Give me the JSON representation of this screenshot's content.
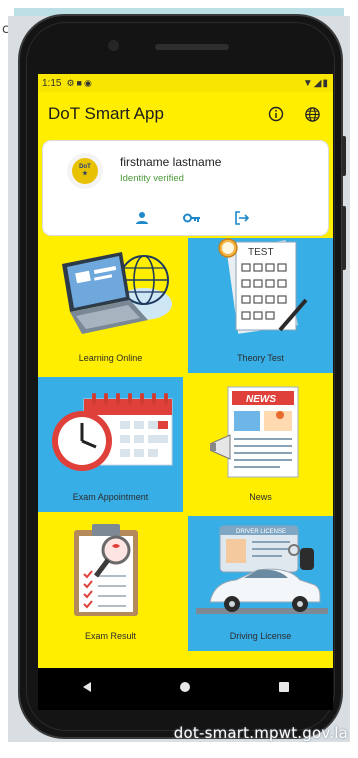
{
  "status_bar": {
    "time": "1:15",
    "left_icons": [
      "settings-icon",
      "sim-icon",
      "hotspot-icon"
    ],
    "right_icons": [
      "wifi-icon",
      "signal-icon",
      "battery-icon"
    ]
  },
  "app_bar": {
    "title": "DoT Smart App",
    "icons": [
      "info-icon",
      "globe-icon"
    ]
  },
  "profile": {
    "name": "firstname lastname",
    "status": "Identity verified",
    "actions": [
      "person-icon",
      "key-icon",
      "logout-icon"
    ]
  },
  "tiles": [
    {
      "id": "learning-online",
      "label": "Learning Online",
      "bg": "#ffee00",
      "icon": "laptop-globe-icon"
    },
    {
      "id": "theory-test",
      "label": "Theory Test",
      "bg": "#38aee6",
      "icon": "test-sheet-icon"
    },
    {
      "id": "exam-appointment",
      "label": "Exam Appointment",
      "bg": "#38aee6",
      "icon": "calendar-clock-icon"
    },
    {
      "id": "news",
      "label": "News",
      "bg": "#ffee00",
      "icon": "newspaper-icon"
    },
    {
      "id": "exam-result",
      "label": "Exam Result",
      "bg": "#ffee00",
      "icon": "clipboard-result-icon"
    },
    {
      "id": "driving-license",
      "label": "Driving License",
      "bg": "#38aee6",
      "icon": "license-car-icon"
    }
  ],
  "colors": {
    "brand_yellow": "#ffee00",
    "tile_blue": "#38aee6",
    "verified_green": "#4a9a3a",
    "action_blue": "#1e88c9"
  },
  "watermark": "dot-smart.mpwt.gov.la",
  "edge_char": "c"
}
